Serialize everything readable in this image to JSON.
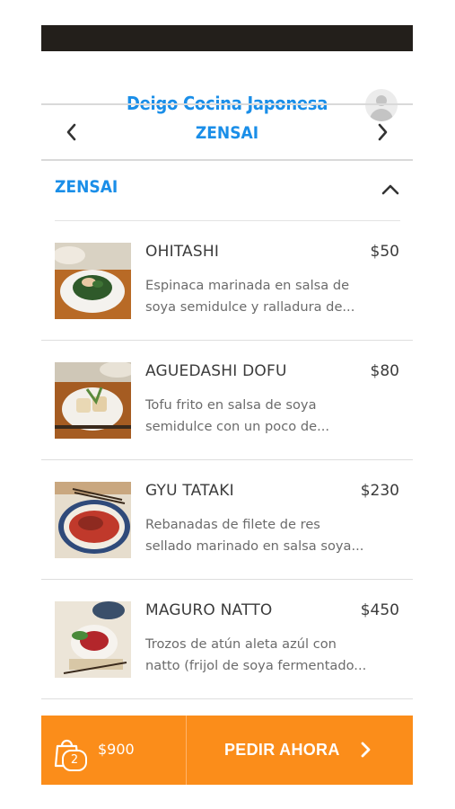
{
  "header": {
    "title": "Deigo Cocina Japonesa",
    "avatar_icon": "user-avatar-icon"
  },
  "category_nav": {
    "title": "ZENSAI",
    "prev_icon": "chevron-left-icon",
    "next_icon": "chevron-right-icon"
  },
  "section": {
    "title": "ZENSAI",
    "toggle_icon": "chevron-up-icon"
  },
  "items": [
    {
      "name": "OHITASHI",
      "price": "$50",
      "desc_line1": "Espinaca marinada en salsa de",
      "desc_line2": "soya semidulce y ralladura de..."
    },
    {
      "name": "AGUEDASHI DOFU",
      "price": "$80",
      "desc_line1": "Tofu frito en salsa de soya",
      "desc_line2": "semidulce con un poco de..."
    },
    {
      "name": "GYU TATAKI",
      "price": "$230",
      "desc_line1": "Rebanadas de filete de res",
      "desc_line2": "sellado marinado en salsa soya..."
    },
    {
      "name": "MAGURO NATTO",
      "price": "$450",
      "desc_line1": "Trozos de atún aleta azúl con",
      "desc_line2": "natto (frijol de soya fermentado..."
    }
  ],
  "cart": {
    "count": "2",
    "total": "$900",
    "order_label": "PEDIR AHORA",
    "bag_icon": "shopping-bag-icon"
  },
  "colors": {
    "brand_blue": "#1a8ee8",
    "accent_orange": "#fb8d1a",
    "status_bar": "#231f1b"
  }
}
